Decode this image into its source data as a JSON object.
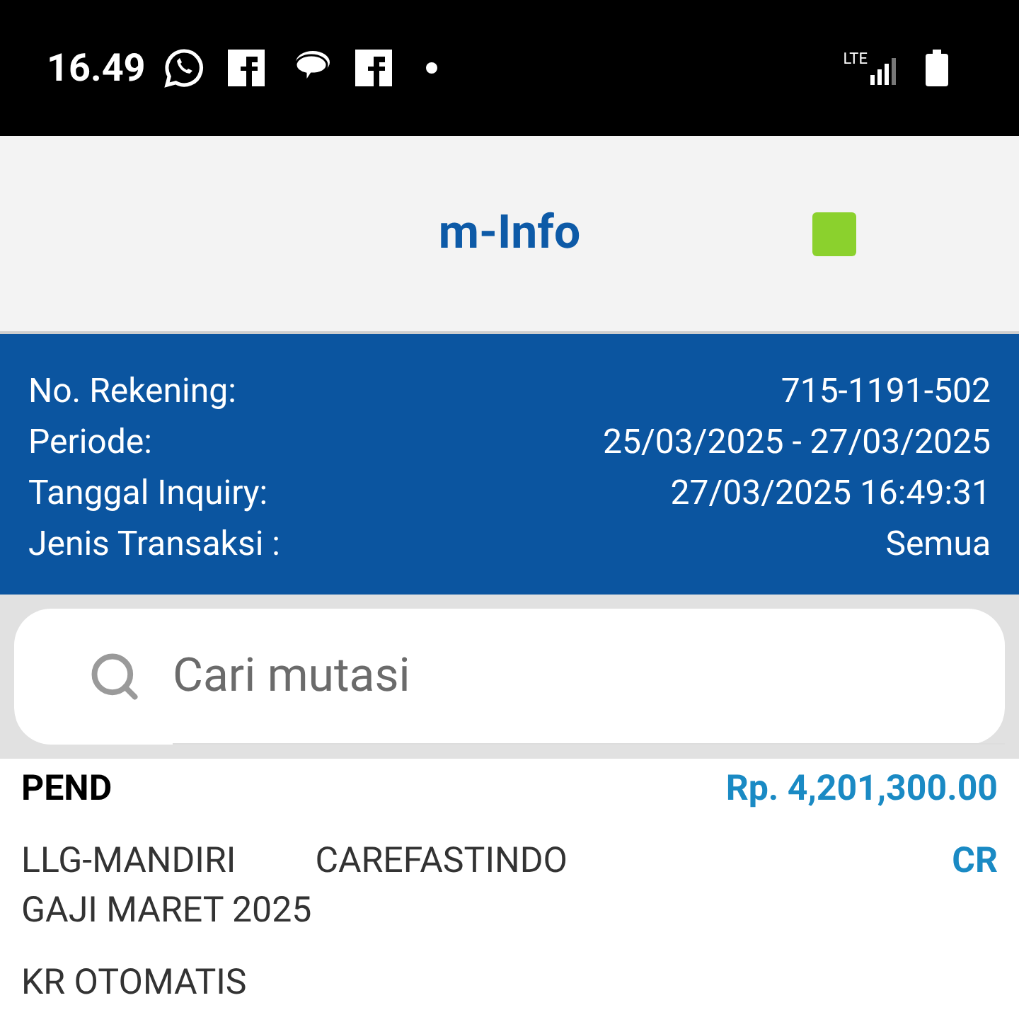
{
  "status_bar": {
    "time": "16.49",
    "network": "LTE"
  },
  "header": {
    "title": "m-Info",
    "indicators": [
      {
        "color": "#8bd12d"
      }
    ]
  },
  "account_info": [
    {
      "label": "No. Rekening:",
      "value": "715-1191-502"
    },
    {
      "label": "Periode:",
      "value": "25/03/2025 - 27/03/2025"
    },
    {
      "label": "Tanggal Inquiry:",
      "value": "27/03/2025 16:49:31"
    },
    {
      "label": "Jenis Transaksi :",
      "value": "Semua"
    }
  ],
  "search": {
    "placeholder": "Cari mutasi"
  },
  "transactions": [
    {
      "status": "PEND",
      "amount": "Rp. 4,201,300.00",
      "description": [
        "LLG-MANDIRI",
        "CAREFASTINDO"
      ],
      "type": "CR",
      "note": "GAJI MARET 2025",
      "category": "KR OTOMATIS"
    }
  ]
}
